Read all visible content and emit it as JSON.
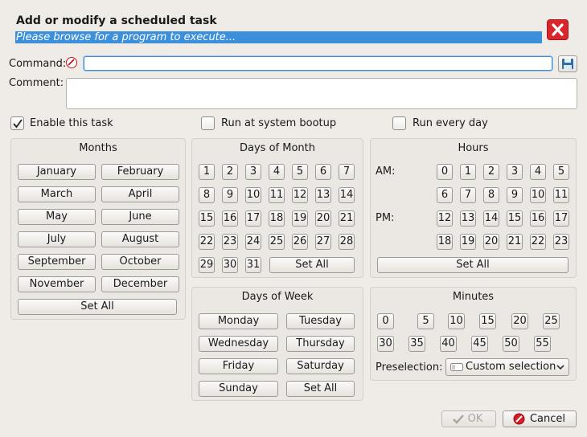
{
  "header": {
    "title": "Add or modify a scheduled task",
    "subtitle": "Please browse for a program to execute..."
  },
  "form": {
    "command_label": "Command:",
    "command_value": "",
    "comment_label": "Comment:",
    "comment_value": ""
  },
  "options": {
    "enable_task": {
      "label": "Enable this task",
      "checked": true
    },
    "run_bootup": {
      "label": "Run at system bootup",
      "checked": false
    },
    "run_every_day": {
      "label": "Run every day",
      "checked": false
    }
  },
  "months": {
    "title": "Months",
    "items": [
      "January",
      "February",
      "March",
      "April",
      "May",
      "June",
      "July",
      "August",
      "September",
      "October",
      "November",
      "December"
    ],
    "set_all": "Set All"
  },
  "days_of_month": {
    "title": "Days of Month",
    "items": [
      "1",
      "2",
      "3",
      "4",
      "5",
      "6",
      "7",
      "8",
      "9",
      "10",
      "11",
      "12",
      "13",
      "14",
      "15",
      "16",
      "17",
      "18",
      "19",
      "20",
      "21",
      "22",
      "23",
      "24",
      "25",
      "26",
      "27",
      "28",
      "29",
      "30",
      "31"
    ],
    "set_all": "Set All"
  },
  "hours": {
    "title": "Hours",
    "am_label": "AM:",
    "pm_label": "PM:",
    "items": [
      "0",
      "1",
      "2",
      "3",
      "4",
      "5",
      "6",
      "7",
      "8",
      "9",
      "10",
      "11",
      "12",
      "13",
      "14",
      "15",
      "16",
      "17",
      "18",
      "19",
      "20",
      "21",
      "22",
      "23"
    ],
    "set_all": "Set All"
  },
  "days_of_week": {
    "title": "Days of Week",
    "items": [
      "Monday",
      "Tuesday",
      "Wednesday",
      "Thursday",
      "Friday",
      "Saturday",
      "Sunday"
    ],
    "set_all": "Set All"
  },
  "minutes": {
    "title": "Minutes",
    "items": [
      "0",
      "5",
      "10",
      "15",
      "20",
      "25",
      "30",
      "35",
      "40",
      "45",
      "50",
      "55"
    ],
    "preselection_label": "Preselection:",
    "preselection_value": "Custom selection"
  },
  "footer": {
    "ok_label": "OK",
    "cancel_label": "Cancel"
  },
  "colors": {
    "accent": "#3c8fdb",
    "close_red": "#d9262c",
    "background": "#efebe7"
  },
  "icons": {
    "close": "close-icon",
    "clear": "clear-icon",
    "browse": "save-icon",
    "ok": "checkmark-icon",
    "cancel": "cancel-icon",
    "combo": "combo-icon",
    "dropdown": "chevron-down-icon"
  }
}
